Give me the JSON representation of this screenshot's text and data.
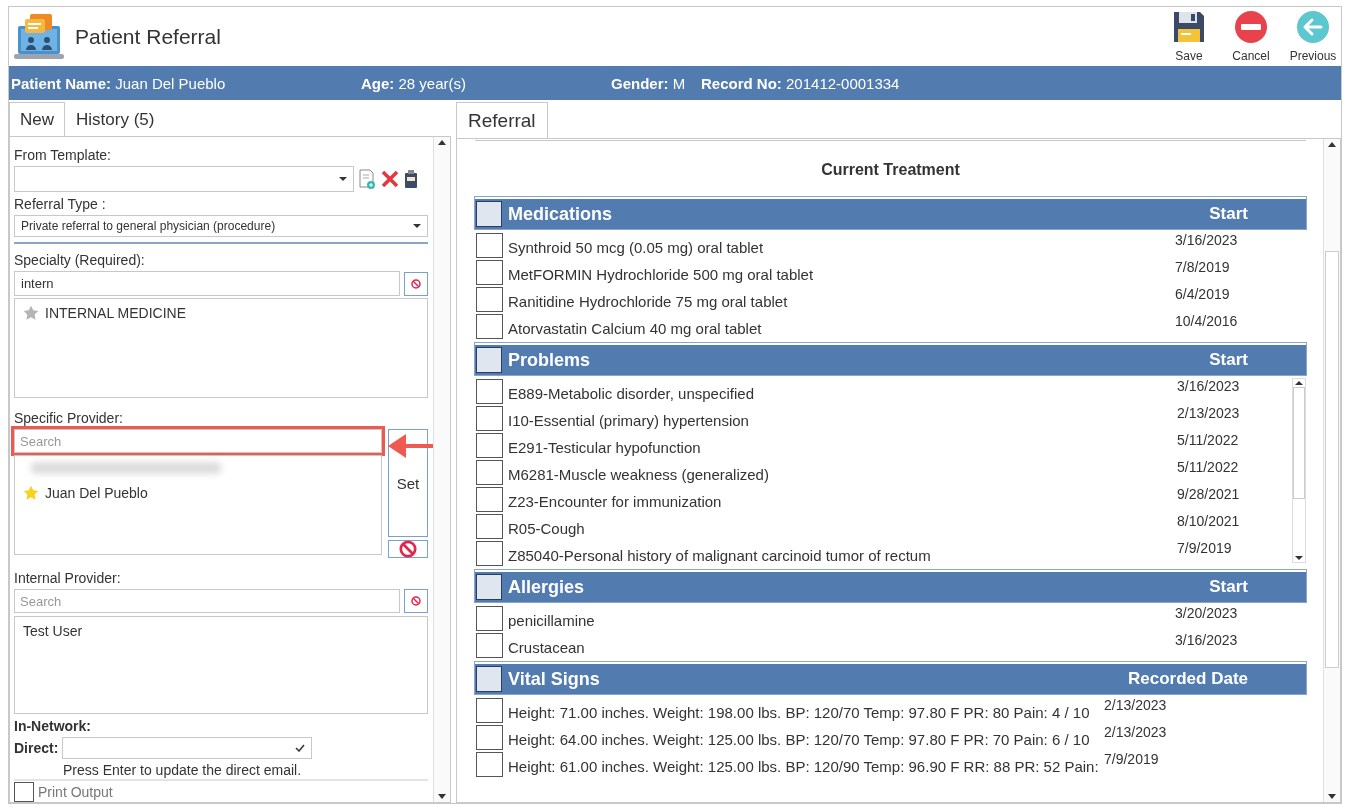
{
  "window": {
    "title": "Patient Referral"
  },
  "toolbar": [
    {
      "kind": "save",
      "label": "Save"
    },
    {
      "kind": "cancel",
      "label": "Cancel"
    },
    {
      "kind": "previous",
      "label": "Previous"
    }
  ],
  "patient": {
    "name_label": "Patient Name:",
    "name": "Juan Del Pueblo",
    "age_label": "Age:",
    "age": "28 year(s)",
    "gender_label": "Gender:",
    "gender": "M",
    "record_label": "Record No:",
    "record": "201412-0001334"
  },
  "left_tabs": [
    {
      "label": "New",
      "selected": true
    },
    {
      "label": "History (5)",
      "selected": false
    }
  ],
  "form": {
    "template_label": "From Template:",
    "referral_type_label": "Referral Type :",
    "referral_type": "Private referral to general physician (procedure)",
    "specialty_label": "Specialty (Required):",
    "specialty_value": "intern",
    "specialties": [
      {
        "name": "INTERNAL MEDICINE",
        "favorite": false
      }
    ],
    "provider_label": "Specific Provider:",
    "provider_placeholder": "Search",
    "provider_search_highlighted": true,
    "providers": [
      {
        "name": "Juan  Del Pueblo",
        "favorite": true
      }
    ],
    "set_button": "Set",
    "internal_label": "Internal Provider:",
    "internal_placeholder": "Search",
    "internal_providers": [
      "Test User"
    ],
    "in_network_label": "In-Network:",
    "direct_label": "Direct:",
    "direct_hint": "Press Enter to update the direct email.",
    "print_output": {
      "label": "Print Output",
      "checked": false
    }
  },
  "right_tabs": [
    {
      "label": "Referral",
      "selected": true
    }
  ],
  "treatment": {
    "title": "Current Treatment",
    "sections": [
      {
        "title": "Medications",
        "date_heading": "Start",
        "all_checked": false,
        "scrollable": false,
        "rows": [
          {
            "text": "Synthroid 50 mcg (0.05 mg) oral tablet",
            "date": "3/16/2023",
            "checked": false
          },
          {
            "text": "MetFORMIN Hydrochloride 500 mg oral tablet",
            "date": "7/8/2019",
            "checked": false
          },
          {
            "text": "Ranitidine Hydrochloride 75 mg oral tablet",
            "date": "6/4/2019",
            "checked": false
          },
          {
            "text": "Atorvastatin Calcium 40 mg oral tablet",
            "date": "10/4/2016",
            "checked": false
          }
        ]
      },
      {
        "title": "Problems",
        "date_heading": "Start",
        "all_checked": false,
        "scrollable": true,
        "rows": [
          {
            "text": "E889-Metabolic disorder, unspecified",
            "date": "3/16/2023",
            "checked": false
          },
          {
            "text": "I10-Essential (primary) hypertension",
            "date": "2/13/2023",
            "checked": false
          },
          {
            "text": "E291-Testicular hypofunction",
            "date": "5/11/2022",
            "checked": false
          },
          {
            "text": "M6281-Muscle weakness (generalized)",
            "date": "5/11/2022",
            "checked": false
          },
          {
            "text": "Z23-Encounter for immunization",
            "date": "9/28/2021",
            "checked": false
          },
          {
            "text": "R05-Cough",
            "date": "8/10/2021",
            "checked": false
          },
          {
            "text": "Z85040-Personal history of malignant carcinoid tumor of rectum",
            "date": "7/9/2019",
            "checked": false
          }
        ]
      },
      {
        "title": "Allergies",
        "date_heading": "Start",
        "all_checked": false,
        "scrollable": false,
        "rows": [
          {
            "text": "penicillamine",
            "date": "3/20/2023",
            "checked": false
          },
          {
            "text": "Crustacean",
            "date": "3/16/2023",
            "checked": false
          }
        ]
      },
      {
        "title": "Vital Signs",
        "date_heading": "Recorded Date",
        "all_checked": false,
        "scrollable": false,
        "rows": [
          {
            "text": "Height: 71.00 inches. Weight: 198.00 lbs. BP: 120/70 Temp: 97.80 F PR: 80 Pain: 4 / 10",
            "date": "2/13/2023",
            "checked": false
          },
          {
            "text": "Height: 64.00 inches. Weight: 125.00 lbs. BP: 120/70 Temp: 97.80 F PR: 70 Pain: 6 / 10",
            "date": "2/13/2023",
            "checked": false
          },
          {
            "text": "Height: 61.00 inches. Weight: 125.00 lbs. BP: 120/90 Temp: 96.90 F RR: 88 PR: 52 Pain:",
            "date": "7/9/2019",
            "checked": false
          }
        ]
      }
    ]
  }
}
